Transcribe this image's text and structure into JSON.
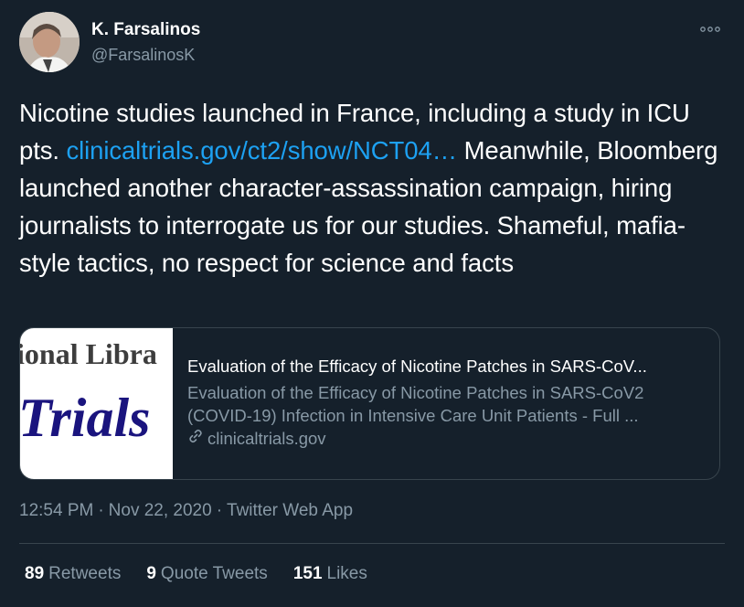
{
  "author": {
    "name": "K. Farsalinos",
    "handle": "@FarsalinosK"
  },
  "tweet": {
    "text_before": "Nicotine studies launched in France, including a study in ICU pts. ",
    "link_text": "clinicaltrials.gov/ct2/show/NCT04…",
    "text_after": " Meanwhile, Bloomberg launched another character-assassination campaign, hiring journalists to interrogate us for our studies. Shameful, mafia-style tactics, no respect for science and facts"
  },
  "card": {
    "thumb_top_text": "ional Libra",
    "thumb_main_text": "Trials",
    "title": "Evaluation of the Efficacy of Nicotine Patches in SARS-CoV...",
    "description": "Evaluation of the Efficacy of Nicotine Patches in SARS-CoV2 (COVID-19) Infection in Intensive Care Unit Patients - Full ...",
    "domain": "clinicaltrials.gov"
  },
  "meta": {
    "time": "12:54 PM",
    "date": "Nov 22, 2020",
    "source": "Twitter Web App",
    "separator": "·"
  },
  "stats": {
    "retweets_count": "89",
    "retweets_label": "Retweets",
    "quotes_count": "9",
    "quotes_label": "Quote Tweets",
    "likes_count": "151",
    "likes_label": "Likes"
  },
  "colors": {
    "background": "#15202b",
    "link": "#1da1f2",
    "secondary_text": "#8899a6",
    "border": "#38444d"
  },
  "icons": {
    "more": "more-options-icon",
    "card_link": "link-icon"
  }
}
